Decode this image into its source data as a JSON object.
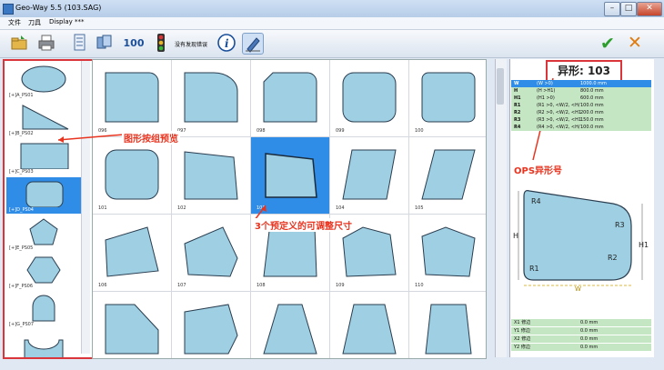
{
  "window": {
    "title": "Geo-Way 5.5 (103.SAG)",
    "minimize": "–",
    "maximize": "□",
    "close": "✕"
  },
  "menu": [
    "文件",
    "刀具",
    "Display ***"
  ],
  "toolbar": {
    "message_button": "没有发现错误",
    "counter_label": "100",
    "ok": "✔",
    "cancel": "✕"
  },
  "left_panel": {
    "items": [
      {
        "label": "[+]A_PS01",
        "shape": "ellipse"
      },
      {
        "label": "[+]B_PS02",
        "shape": "triangle"
      },
      {
        "label": "[+]C_PS03",
        "shape": "rectangle"
      },
      {
        "label": "[+]D_PS04",
        "shape": "rounded-rectangle",
        "selected": true
      },
      {
        "label": "[+]E_PS05",
        "shape": "pentagon"
      },
      {
        "label": "[+]F_PS06",
        "shape": "hexagon"
      },
      {
        "label": "[+]G_PS07",
        "shape": "arch"
      },
      {
        "label": "",
        "shape": "notch"
      }
    ]
  },
  "grid": {
    "cells": [
      {
        "label": "096"
      },
      {
        "label": "097"
      },
      {
        "label": "098"
      },
      {
        "label": "099"
      },
      {
        "label": "100"
      },
      {
        "label": "101"
      },
      {
        "label": "102"
      },
      {
        "label": "103",
        "selected": true
      },
      {
        "label": "104"
      },
      {
        "label": "105"
      },
      {
        "label": "106"
      },
      {
        "label": "107"
      },
      {
        "label": "108"
      },
      {
        "label": "109"
      },
      {
        "label": "110"
      },
      {
        "label": ""
      },
      {
        "label": ""
      },
      {
        "label": ""
      },
      {
        "label": ""
      },
      {
        "label": ""
      }
    ]
  },
  "annotations": {
    "preview": "图形按组预览",
    "dims": "3个预定义的可调整尺寸",
    "ops": "OPS异形号"
  },
  "right_panel": {
    "shape_title": "异形: 103",
    "params": [
      {
        "name": "W",
        "desc": "(W >0)",
        "value": "1000.0 mm",
        "highlight": true
      },
      {
        "name": "H",
        "desc": "(H >H1)",
        "value": "800.0 mm"
      },
      {
        "name": "H1",
        "desc": "(H1 >0)",
        "value": "600.0 mm"
      },
      {
        "name": "R1",
        "desc": "(R1 >0, <W/2, <H/",
        "value": "100.0 mm"
      },
      {
        "name": "R2",
        "desc": "(R2 >0, <W/2, <H1",
        "value": "200.0 mm"
      },
      {
        "name": "R3",
        "desc": "(R3 >0, <W/2, <H1",
        "value": "150.0 mm"
      },
      {
        "name": "R4",
        "desc": "(R4 >0, <W/2, <H/",
        "value": "100.0 mm"
      }
    ],
    "preview_labels": {
      "r4": "R4",
      "r3": "R3",
      "r2": "R2",
      "r1": "R1",
      "h": "H",
      "h1": "H1",
      "w": "W"
    },
    "trims": [
      {
        "name": "X1 修边",
        "value": "0.0 mm"
      },
      {
        "name": "Y1 修边",
        "value": "0.0 mm"
      },
      {
        "name": "X2 修边",
        "value": "0.0 mm"
      },
      {
        "name": "Y2 修边",
        "value": "0.0 mm"
      }
    ]
  },
  "colors": {
    "shape_fill": "#9ecfe3",
    "selected": "#2f8de8",
    "annotation": "#e8341f"
  }
}
